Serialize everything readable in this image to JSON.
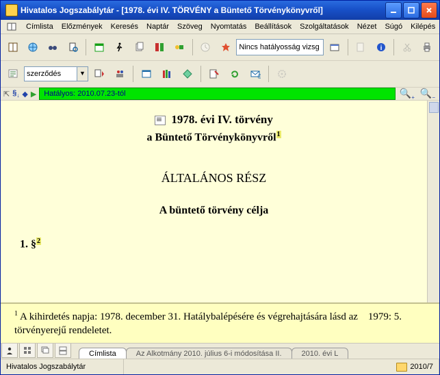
{
  "title": "Hivatalos Jogszabálytár - [1978. évi IV. TÖRVÉNY a Büntető Törvénykönyvről]",
  "menu": {
    "m0": "Címlista",
    "m1": "Előzmények",
    "m2": "Keresés",
    "m3": "Naptár",
    "m4": "Szöveg",
    "m5": "Nyomtatás",
    "m6": "Beállítások",
    "m7": "Szolgáltatások",
    "m8": "Nézet",
    "m9": "Súgó",
    "m10": "Kilépés"
  },
  "toolbar": {
    "searchField": "Nincs hatályosság vizsg",
    "combo": "szerződés"
  },
  "validity": {
    "text": "Hatályos: 2010.07.23-tól"
  },
  "doc": {
    "line1": "1978. évi IV. törvény",
    "line2": "a Büntető Törvénykönyvről",
    "fn1": "1",
    "h1": "ÁLTALÁNOS RÉSZ",
    "h2": "A büntető törvény célja",
    "para": "1. §",
    "fn2": "2"
  },
  "footnote": {
    "num": "1",
    "textA": "A kihirdetés napja: 1978. december 31. Hatálybalépésére és végrehajtására lásd az",
    "textB": "1979: 5. törvényerejű rendeletet."
  },
  "tabs": {
    "t1": "Címlista",
    "t2": "Az Alkotmány 2010. július 6-i módosítása II.",
    "t3": "2010. évi L"
  },
  "status": {
    "app": "Hivatalos Jogszabálytár",
    "period": "2010/7"
  }
}
